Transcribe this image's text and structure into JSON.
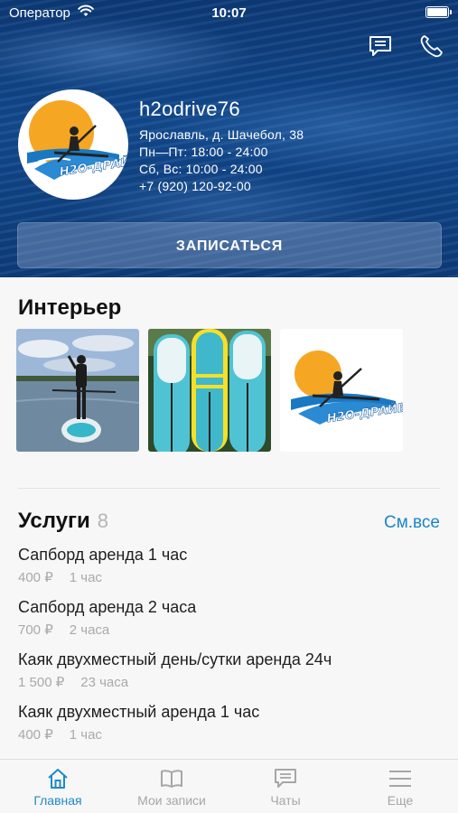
{
  "status_bar": {
    "carrier": "Оператор",
    "time": "10:07"
  },
  "header": {
    "chat_icon": "chat-icon",
    "phone_icon": "phone-icon"
  },
  "profile": {
    "name": "h2odrive76",
    "address": "Ярославль, д. Шачебол, 38",
    "hours_weekdays": "Пн—Пт: 18:00 - 24:00",
    "hours_weekend": "Сб, Вс: 10:00 - 24:00",
    "phone": "+7 (920) 120-92-00",
    "logo_text": "H2O-ДРАЙВ"
  },
  "book_button": "ЗАПИСАТЬСЯ",
  "interior": {
    "title": "Интерьер"
  },
  "services": {
    "title": "Услуги",
    "count": "8",
    "see_all": "См.все",
    "items": [
      {
        "name": "Сапборд  аренда 1 час",
        "price": "400 ₽",
        "duration": "1 час"
      },
      {
        "name": "Сапборд аренда 2 часа",
        "price": "700 ₽",
        "duration": "2 часа"
      },
      {
        "name": "Каяк двухместный день/сутки аренда 24ч",
        "price": "1 500 ₽",
        "duration": "23 часа"
      },
      {
        "name": "Каяк двухместный аренда 1 час",
        "price": "400 ₽",
        "duration": "1 час"
      }
    ]
  },
  "tabbar": {
    "tabs": [
      {
        "label": "Главная",
        "icon": "home-icon",
        "active": true
      },
      {
        "label": "Мои записи",
        "icon": "book-icon",
        "active": false
      },
      {
        "label": "Чаты",
        "icon": "chat-icon",
        "active": false
      },
      {
        "label": "Еще",
        "icon": "menu-icon",
        "active": false
      }
    ]
  },
  "colors": {
    "accent": "#1f89c9",
    "hero": "#124a8f",
    "logo_sun": "#f5a623",
    "logo_wave": "#1a78c2"
  }
}
